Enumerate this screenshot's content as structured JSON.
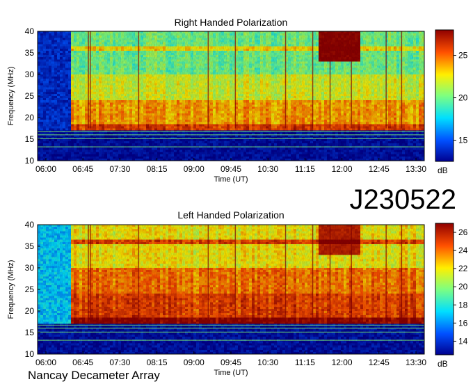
{
  "observation_id": "J230522",
  "footer": "Nancay Decameter Array",
  "colors": {
    "colormap": [
      "#00008f",
      "#0050ff",
      "#00dfff",
      "#7fff7f",
      "#ffef00",
      "#ff5000",
      "#8f0000"
    ]
  },
  "chart_data": [
    {
      "type": "heatmap",
      "title": "Right Handed Polarization",
      "xlabel": "Time (UT)",
      "ylabel": "Frequency (MHz)",
      "x_ticks": [
        "06:00",
        "06:45",
        "07:30",
        "08:15",
        "09:00",
        "09:45",
        "10:30",
        "11:15",
        "12:00",
        "12:45",
        "13:30"
      ],
      "y_ticks": [
        10,
        15,
        20,
        25,
        30,
        35,
        40
      ],
      "ylim": [
        10,
        40
      ],
      "colorbar": {
        "label": "dB",
        "ticks": [
          15,
          20,
          25
        ],
        "range": [
          12.5,
          28
        ]
      },
      "typical_levels_db": {
        "below_17_MHz": 13,
        "band_17_24_MHz": 24,
        "band_24_30_MHz": 22,
        "band_30_40_MHz": 20,
        "early_blue_section_before_06_30": 14,
        "burst_near_12_00_above_33_MHz": 28
      }
    },
    {
      "type": "heatmap",
      "title": "Left Handed Polarization",
      "xlabel": "Time (UT)",
      "ylabel": "Frequency (MHz)",
      "x_ticks": [
        "06:00",
        "06:45",
        "07:30",
        "08:15",
        "09:00",
        "09:45",
        "10:30",
        "11:15",
        "12:00",
        "12:45",
        "13:30"
      ],
      "y_ticks": [
        10,
        15,
        20,
        25,
        30,
        35,
        40
      ],
      "ylim": [
        10,
        40
      ],
      "colorbar": {
        "label": "dB",
        "ticks": [
          14,
          16,
          18,
          20,
          22,
          24,
          26
        ],
        "range": [
          12.5,
          27
        ]
      },
      "typical_levels_db": {
        "below_17_MHz": 13,
        "band_17_24_MHz": 25,
        "band_24_30_MHz": 24,
        "band_30_40_MHz": 22,
        "early_blue_section_before_06_30": 17,
        "burst_near_12_00_above_33_MHz": 26
      }
    }
  ]
}
